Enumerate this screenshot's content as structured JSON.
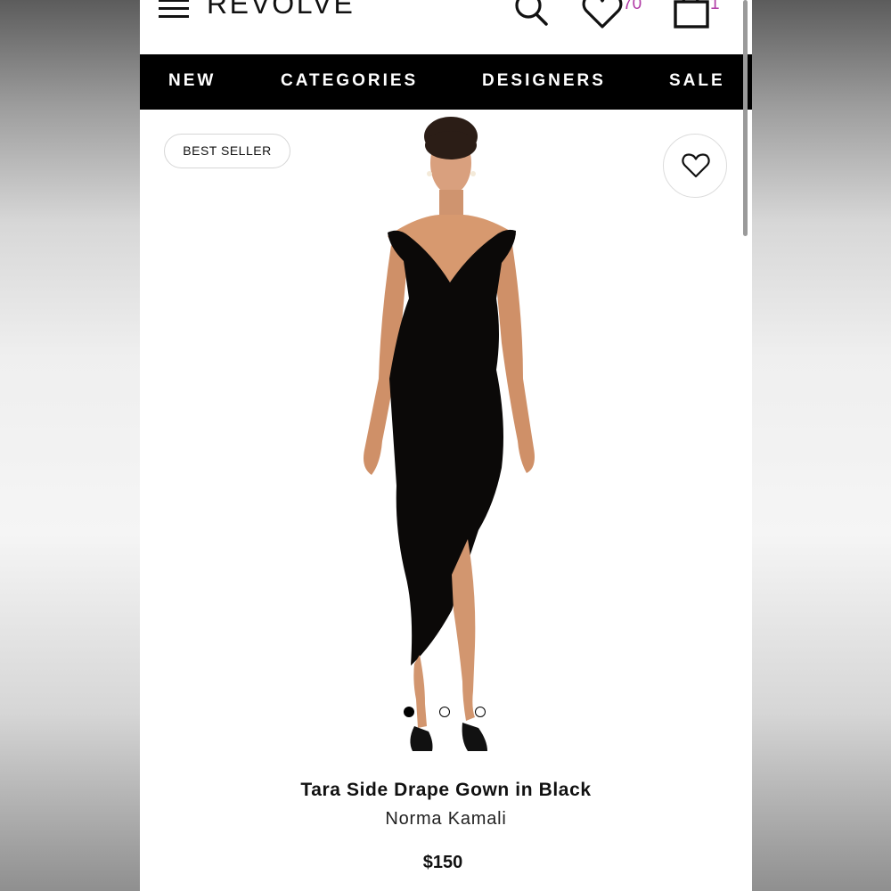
{
  "header": {
    "logo": "REVOLVE",
    "wishlist_count": "70",
    "bag_count": "1",
    "count_color": "#b03aa5"
  },
  "nav": {
    "items": [
      "NEW",
      "CATEGORIES",
      "DESIGNERS",
      "SALE"
    ]
  },
  "product": {
    "badge": "BEST SELLER",
    "title": "Tara Side Drape Gown in Black",
    "brand": "Norma Kamali",
    "price": "$150",
    "image_carousel": {
      "total_images": 3,
      "active_index": 0
    }
  },
  "icons": {
    "menu": "hamburger-icon",
    "search": "search-icon",
    "wishlist": "heart-icon",
    "bag": "shopping-bag-icon",
    "favorite": "heart-outline-icon"
  }
}
